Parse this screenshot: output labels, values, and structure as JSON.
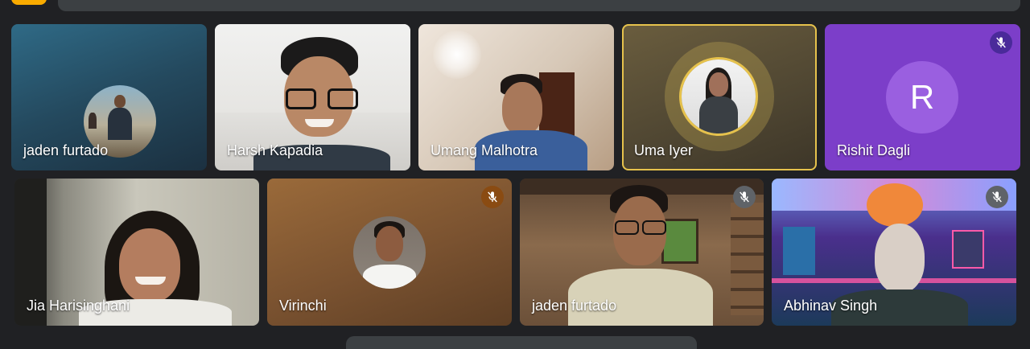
{
  "participants": [
    {
      "name": "jaden furtado",
      "muted": false
    },
    {
      "name": "Harsh Kapadia",
      "muted": false
    },
    {
      "name": "Umang Malhotra",
      "muted": false
    },
    {
      "name": "Uma Iyer",
      "muted": false,
      "speaking": true
    },
    {
      "name": "Rishit Dagli",
      "muted": true,
      "initial": "R"
    },
    {
      "name": "Jia Harisinghani",
      "muted": false
    },
    {
      "name": "Virinchi",
      "muted": true
    },
    {
      "name": "jaden furtado",
      "muted": true
    },
    {
      "name": "Abhinav Singh",
      "muted": true
    }
  ],
  "icons": {
    "mute": "mic-off-icon"
  },
  "colors": {
    "speaking_border": "#e6c24c",
    "muted_badge_purple": "#4a2a9a",
    "muted_badge_orange": "#8a4b12",
    "muted_badge_gray": "#5f6368",
    "rishit_tile": "#7c3ec9",
    "rishit_avatar": "#9a5fe0",
    "background": "#202124"
  }
}
